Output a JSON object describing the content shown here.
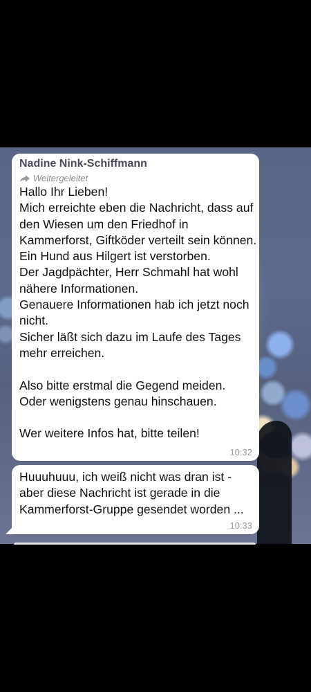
{
  "messages": [
    {
      "sender": "Nadine Nink-Schiffmann",
      "forwarded_label": "Weitergeleitet",
      "text": "Hallo Ihr Lieben!\nMich erreichte eben die Nachricht, dass auf den Wiesen um den Friedhof in Kammerforst, Giftköder verteilt sein können.\nEin Hund aus Hilgert ist verstorben.\nDer Jagdpächter, Herr Schmahl hat wohl nähere Informationen.\nGenauere Informationen hab ich jetzt noch nicht.\nSicher läßt sich dazu im Laufe des Tages mehr erreichen.\n\nAlso bitte erstmal die Gegend meiden.\nOder wenigstens genau hinschauen.\n\nWer weitere Infos hat, bitte teilen!",
      "time": "10:32"
    },
    {
      "text": "Huuuhuuu, ich weiß nicht was dran ist - aber diese Nachricht ist gerade in die Kammerforst-Gruppe gesendet worden ...",
      "time": "10:33"
    }
  ],
  "icons": {
    "forward": "forward-arrow-icon"
  },
  "colors": {
    "bubble": "#ffffff",
    "sender": "#4a4a5a",
    "meta": "#9a9aa0"
  }
}
